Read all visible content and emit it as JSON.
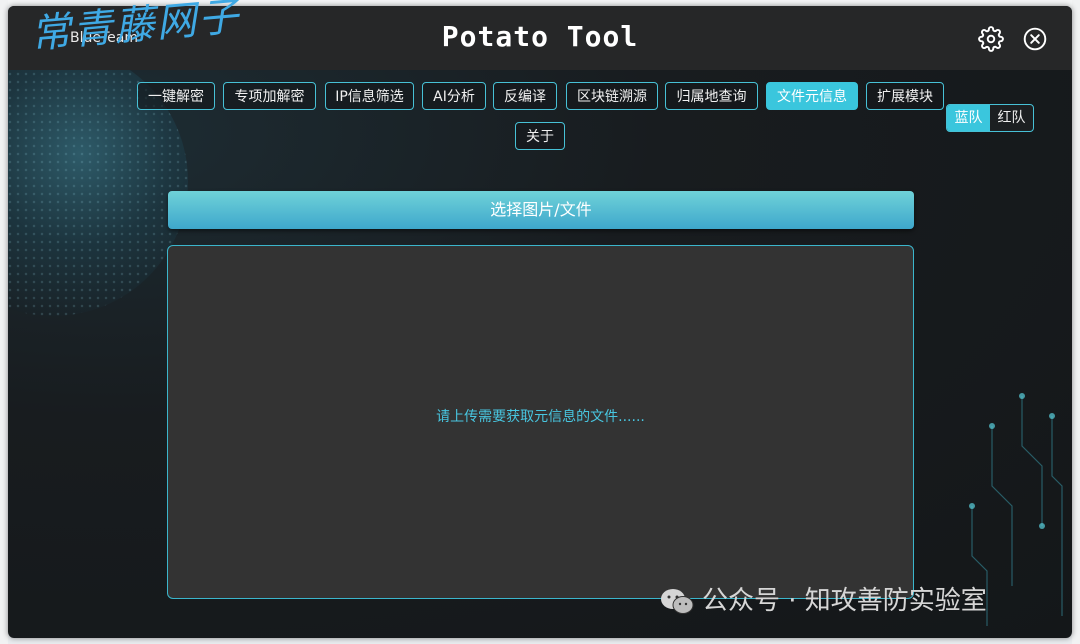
{
  "app": {
    "name": "BlueTeam",
    "title": "Potato Tool"
  },
  "titlebar": {
    "settings_icon": "gear-icon",
    "close_icon": "close-circle-icon"
  },
  "nav": {
    "tabs": [
      {
        "label": "一键解密",
        "active": false
      },
      {
        "label": "专项加解密",
        "active": false
      },
      {
        "label": "IP信息筛选",
        "active": false
      },
      {
        "label": "AI分析",
        "active": false
      },
      {
        "label": "反编译",
        "active": false
      },
      {
        "label": "区块链溯源",
        "active": false
      },
      {
        "label": "归属地查询",
        "active": false
      },
      {
        "label": "文件元信息",
        "active": true
      },
      {
        "label": "扩展模块",
        "active": false
      },
      {
        "label": "关于",
        "active": false
      }
    ]
  },
  "team": {
    "blue": "蓝队",
    "red": "红队",
    "selected": "蓝队"
  },
  "main": {
    "select_button": "选择图片/文件",
    "placeholder": "请上传需要获取元信息的文件......"
  },
  "watermarks": {
    "top": "常青藤网子",
    "bottom": "公众号 · 知攻善防实验室"
  },
  "colors": {
    "accent": "#3ac6dd",
    "border": "#47c1d6",
    "titlebar": "#262728",
    "panel": "#333333"
  }
}
